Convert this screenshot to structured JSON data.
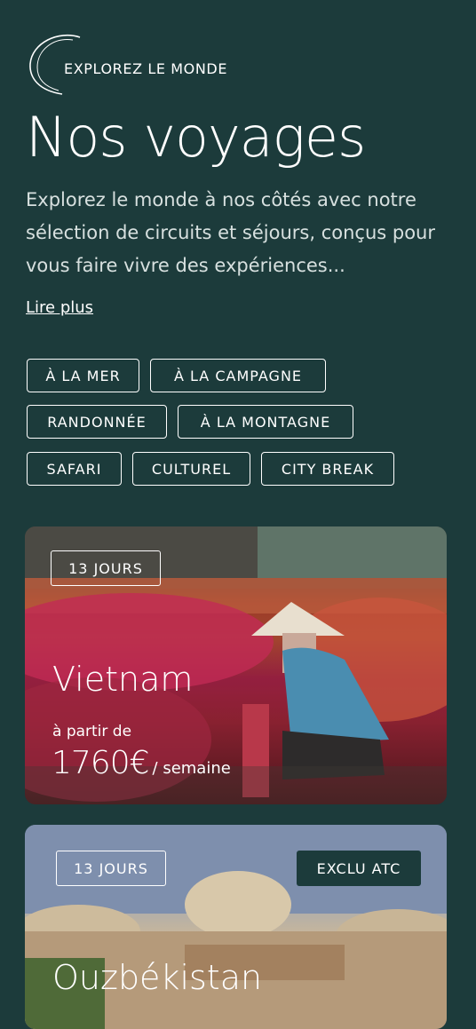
{
  "header": {
    "eyebrow": "EXPLOREZ LE MONDE",
    "title": "Nos voyages",
    "intro": "Explorez le monde à nos côtés avec notre sélection de circuits et séjours, conçus pour vous faire vivre des expériences...",
    "read_more": "Lire plus"
  },
  "filters": [
    "À LA MER",
    "À LA CAMPAGNE",
    "RANDONNÉE",
    "À LA MONTAGNE",
    "SAFARI",
    "CULTUREL",
    "CITY BREAK"
  ],
  "cards": [
    {
      "duration": "13 JOURS",
      "title": "Vietnam",
      "price_from": "à partir de",
      "price": "1760€",
      "price_unit": "/ semaine"
    },
    {
      "duration": "13 JOURS",
      "exclusive": "EXCLU ATC",
      "title": "Ouzbékistan"
    }
  ],
  "colors": {
    "background": "#1c3b3b",
    "text": "#ffffff"
  }
}
